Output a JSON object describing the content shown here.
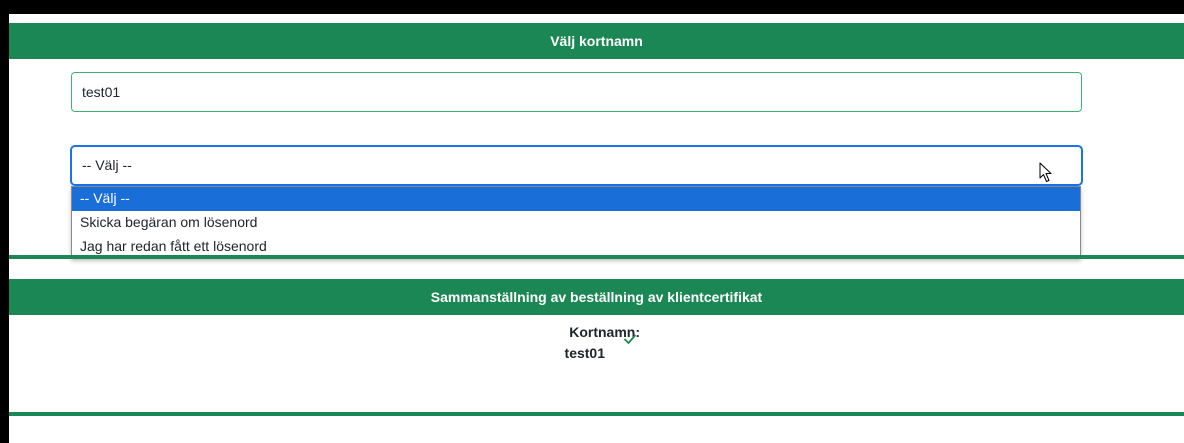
{
  "section1": {
    "title": "Välj kortnamn",
    "shortname_value": "test01"
  },
  "select": {
    "current": "-- Välj --",
    "options": [
      "-- Välj --",
      "Skicka begäran om lösenord",
      "Jag har redan fått ett lösenord"
    ],
    "highlighted_index": 0
  },
  "section2": {
    "title": "Sammanställning av beställning av klientcertifikat",
    "summary_label": "Kortnamn:",
    "summary_value": "test01"
  },
  "icons": {
    "check": "check-icon",
    "cursor": "mouse-pointer-icon"
  },
  "colors": {
    "brand_green": "#1a8754",
    "focus_blue": "#1a73e8",
    "selected_option": "#1a6ed8"
  }
}
